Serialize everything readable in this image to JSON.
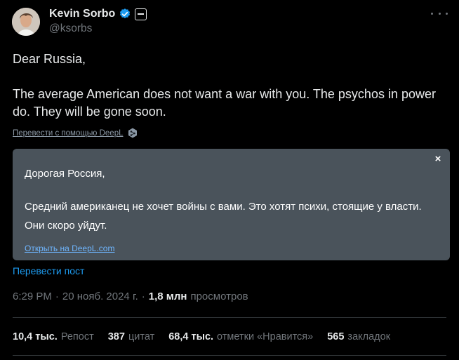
{
  "author": {
    "display_name": "Kevin Sorbo",
    "handle": "@ksorbs",
    "verified_icon": "verified-check-icon",
    "affiliate_icon": "affiliate-badge-icon"
  },
  "tweet": {
    "line1": "Dear Russia,",
    "line2": "The average American does not want a war with you. The psychos in power do. They will be gone soon."
  },
  "deepl": {
    "translate_with": "Перевести с помощью DeepL"
  },
  "translation": {
    "line1": "Дорогая Россия,",
    "line2": " Средний американец не хочет войны с вами. Это хотят психи, стоящие у власти. Они скоро уйдут.",
    "open_link": "Открыть на DeepL.com",
    "close_symbol": "×"
  },
  "translate_post": "Перевести пост",
  "meta": {
    "time": "6:29 PM",
    "date": "20 нояб. 2024 г.",
    "separator": "·",
    "views_count": "1,8 млн",
    "views_label": "просмотров"
  },
  "stats": [
    {
      "num": "10,4 тыс.",
      "label": "Репост"
    },
    {
      "num": "387",
      "label": "цитат"
    },
    {
      "num": "68,4 тыс.",
      "label": "отметки «Нравится»"
    },
    {
      "num": "565",
      "label": "закладок"
    }
  ],
  "colors": {
    "background": "#000000",
    "text": "#e7e9ea",
    "muted": "#71767b",
    "accent": "#1d9bf0",
    "translation_box": "#4a535b"
  }
}
